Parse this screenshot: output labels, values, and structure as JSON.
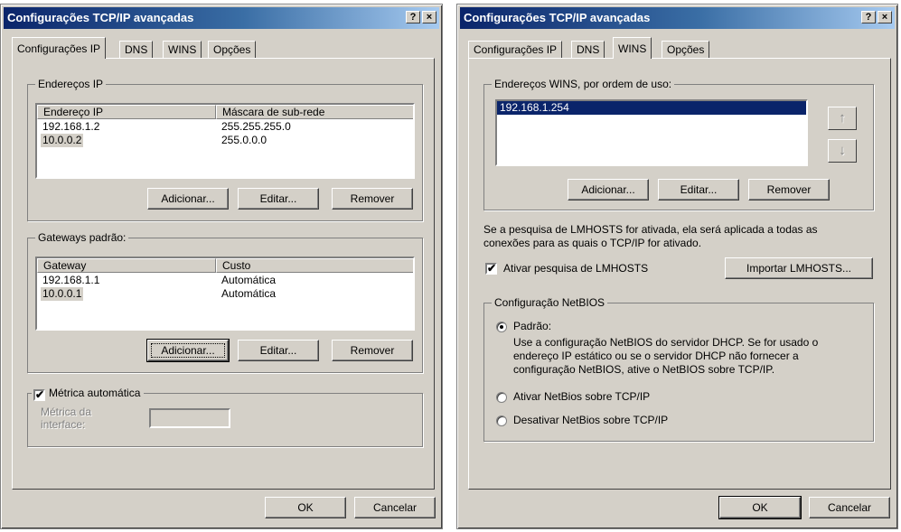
{
  "left": {
    "title": "Configurações TCP/IP avançadas",
    "help": "?",
    "close": "×",
    "tabs": [
      "Configurações IP",
      "DNS",
      "WINS",
      "Opções"
    ],
    "ip_group": {
      "legend": "Endereços IP",
      "headers": [
        "Endereço IP",
        "Máscara de sub-rede"
      ],
      "rows": [
        [
          "192.168.1.2",
          "255.255.255.0"
        ],
        [
          "10.0.0.2",
          "255.0.0.0"
        ]
      ],
      "add": "Adicionar...",
      "edit": "Editar...",
      "remove": "Remover"
    },
    "gw_group": {
      "legend": "Gateways padrão:",
      "headers": [
        "Gateway",
        "Custo"
      ],
      "rows": [
        [
          "192.168.1.1",
          "Automática"
        ],
        [
          "10.0.0.1",
          "Automática"
        ]
      ],
      "add": "Adicionar...",
      "edit": "Editar...",
      "remove": "Remover"
    },
    "metric": {
      "checkbox_label": "Métrica automática",
      "checked": true,
      "field_label_1": "Métrica da",
      "field_label_2": "interface:"
    },
    "ok": "OK",
    "cancel": "Cancelar"
  },
  "right": {
    "title": "Configurações TCP/IP avançadas",
    "help": "?",
    "close": "×",
    "tabs": [
      "Configurações IP",
      "DNS",
      "WINS",
      "Opções"
    ],
    "wins_group": {
      "legend": "Endereços WINS, por ordem de uso:",
      "items": [
        "192.168.1.254"
      ],
      "up_icon": "↑",
      "down_icon": "↓",
      "add": "Adicionar...",
      "edit": "Editar...",
      "remove": "Remover"
    },
    "lmhosts_text_1": "Se a pesquisa de LMHOSTS for ativada, ela será aplicada a todas as",
    "lmhosts_text_2": "conexões para as quais o TCP/IP for ativado.",
    "lmhosts_checkbox": "Ativar pesquisa de LMHOSTS",
    "lmhosts_checked": true,
    "import_button": "Importar LMHOSTS...",
    "netbios": {
      "legend": "Configuração NetBIOS",
      "default_label": "Padrão:",
      "default_desc_1": "Use a configuração NetBIOS do servidor DHCP. Se for usado o",
      "default_desc_2": "endereço IP estático ou se o servidor DHCP não fornecer a",
      "default_desc_3": "configuração NetBIOS, ative o NetBIOS sobre TCP/IP.",
      "enable_label": "Ativar NetBios sobre TCP/IP",
      "disable_label": "Desativar NetBios sobre TCP/IP",
      "selected": "Padrão"
    },
    "ok": "OK",
    "cancel": "Cancelar"
  }
}
